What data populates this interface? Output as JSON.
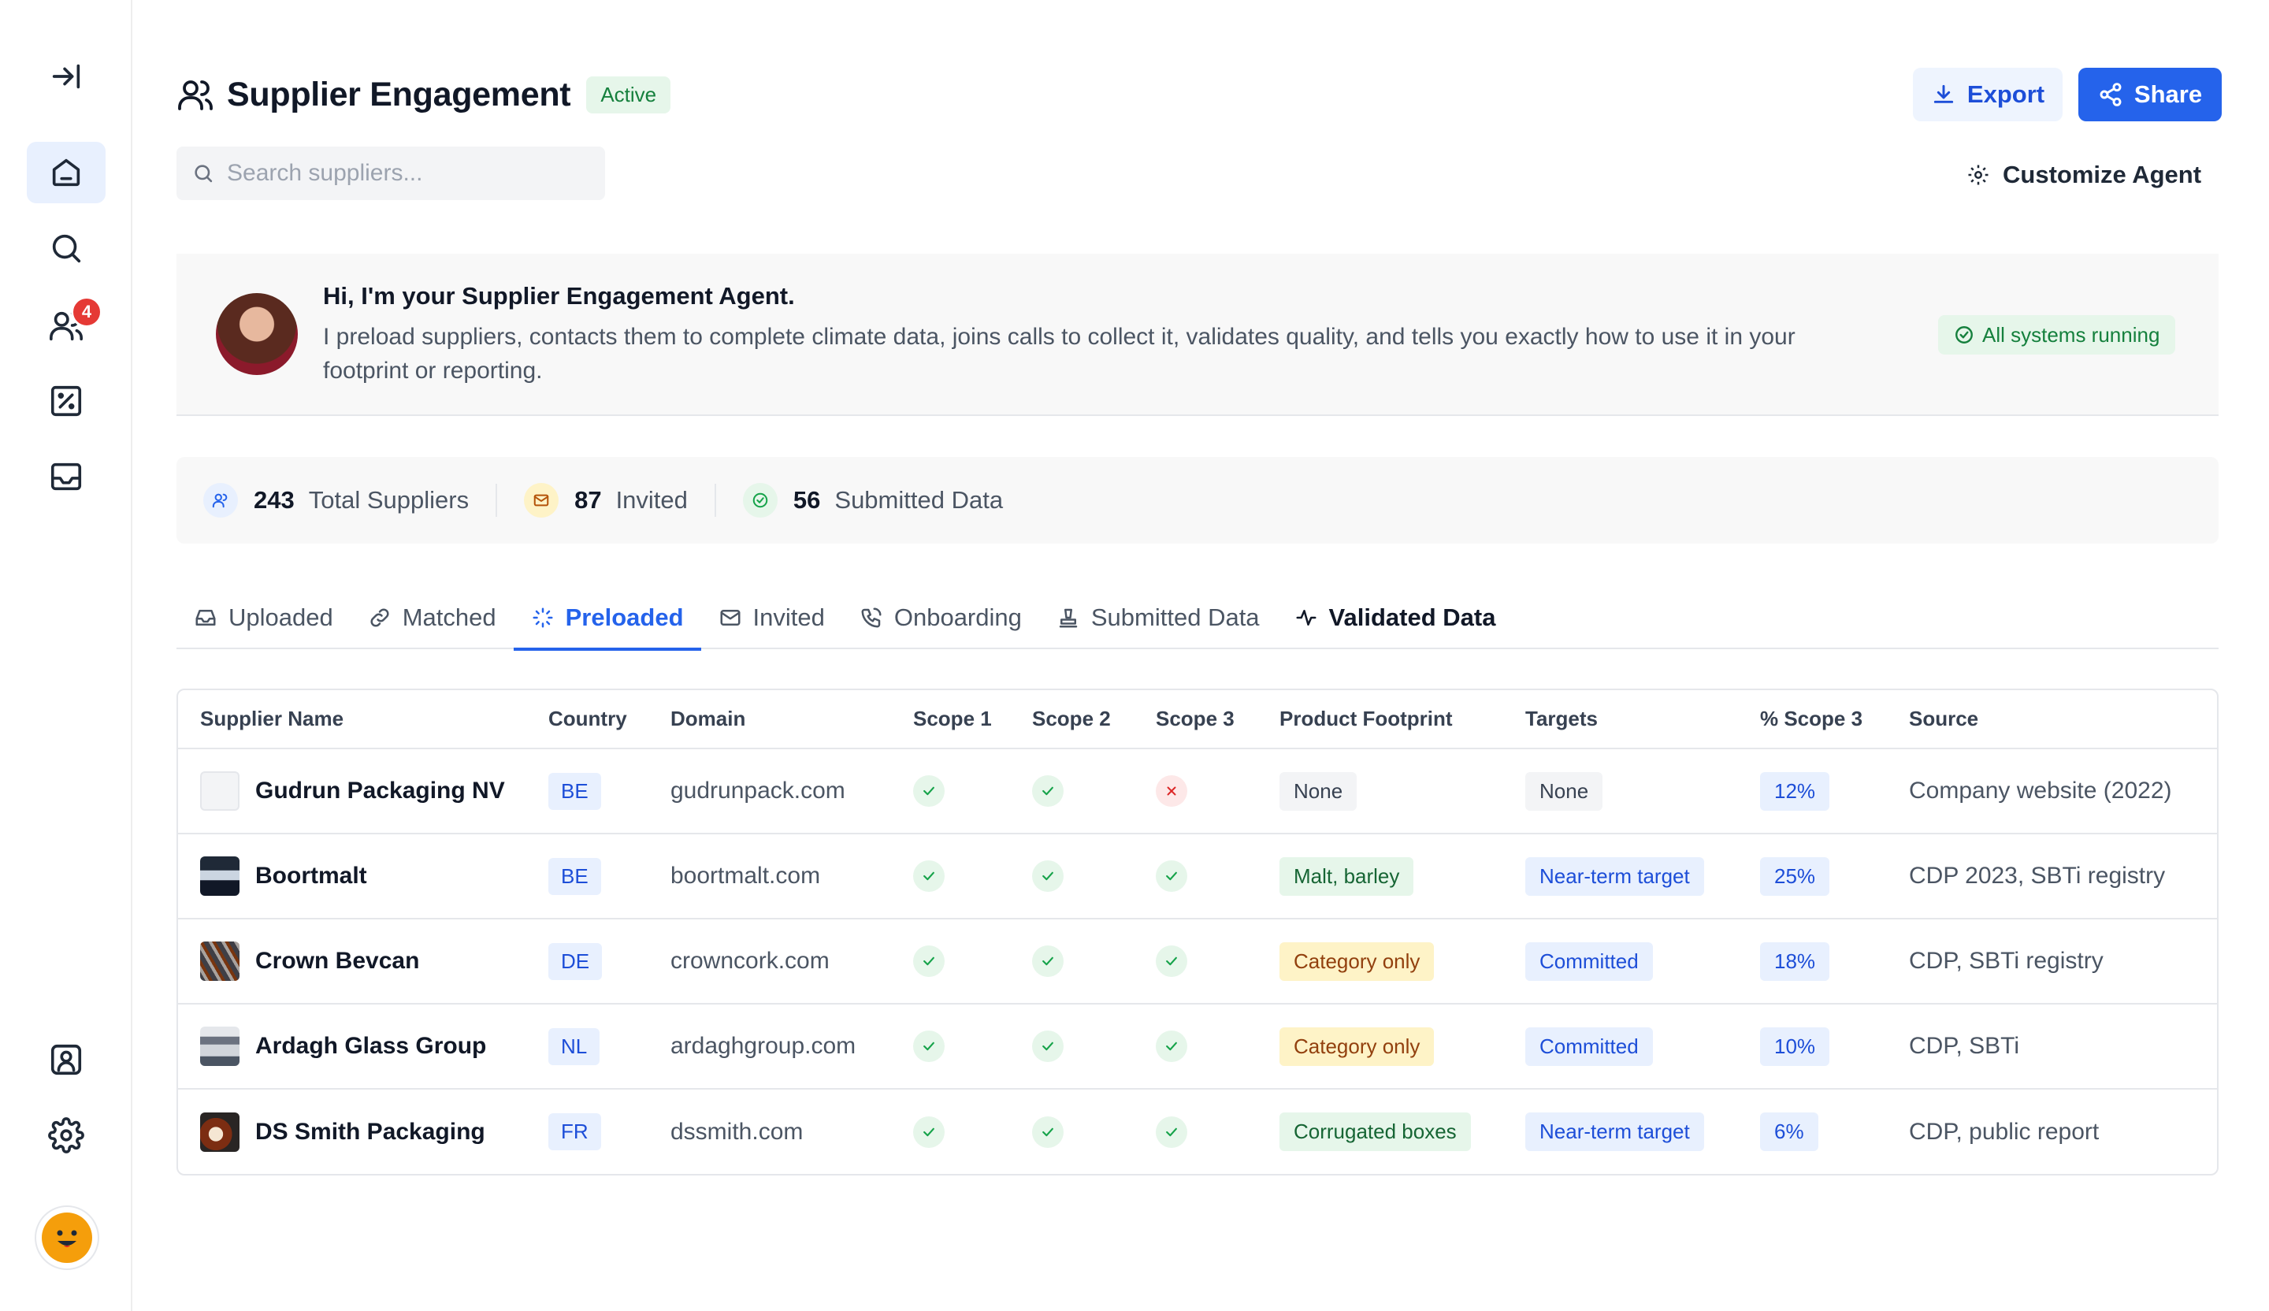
{
  "sidebar": {
    "notification_count": "4"
  },
  "header": {
    "title": "Supplier Engagement",
    "status": "Active",
    "export_label": "Export",
    "share_label": "Share",
    "customize_label": "Customize Agent"
  },
  "search": {
    "placeholder": "Search suppliers...",
    "value": ""
  },
  "agent": {
    "title": "Hi, I'm your Supplier Engagement Agent.",
    "description": "I preload suppliers, contacts them to complete climate data, joins calls to collect it, validates quality, and tells you exactly how to use it in your footprint or reporting.",
    "status": "All systems running"
  },
  "stats": [
    {
      "value": "243",
      "label": "Total Suppliers"
    },
    {
      "value": "87",
      "label": "Invited"
    },
    {
      "value": "56",
      "label": "Submitted Data"
    }
  ],
  "tabs": [
    {
      "label": "Uploaded"
    },
    {
      "label": "Matched"
    },
    {
      "label": "Preloaded"
    },
    {
      "label": "Invited"
    },
    {
      "label": "Onboarding"
    },
    {
      "label": "Submitted Data"
    },
    {
      "label": "Validated Data"
    }
  ],
  "table": {
    "columns": [
      "Supplier Name",
      "Country",
      "Domain",
      "Scope 1",
      "Scope 2",
      "Scope 3",
      "Product Footprint",
      "Targets",
      "% Scope 3",
      "Source"
    ],
    "rows": [
      {
        "name": "Gudrun Packaging NV",
        "country": "BE",
        "domain": "gudrunpack.com",
        "footprint": "None",
        "targets": "None",
        "scope3_pct": "12%",
        "source": "Company website (2022)"
      },
      {
        "name": "Boortmalt",
        "country": "BE",
        "domain": "boortmalt.com",
        "footprint": "Malt, barley",
        "targets": "Near-term target",
        "scope3_pct": "25%",
        "source": "CDP 2023, SBTi registry"
      },
      {
        "name": "Crown Bevcan",
        "country": "DE",
        "domain": "crowncork.com",
        "footprint": "Category only",
        "targets": "Committed",
        "scope3_pct": "18%",
        "source": "CDP, SBTi registry"
      },
      {
        "name": "Ardagh Glass Group",
        "country": "NL",
        "domain": "ardaghgroup.com",
        "footprint": "Category only",
        "targets": "Committed",
        "scope3_pct": "10%",
        "source": "CDP, SBTi"
      },
      {
        "name": "DS Smith Packaging",
        "country": "FR",
        "domain": "dssmith.com",
        "footprint": "Corrugated boxes",
        "targets": "Near-term target",
        "scope3_pct": "6%",
        "source": "CDP, public report"
      }
    ]
  },
  "colors": {
    "accent": "#2563eb",
    "success": "#16a34a",
    "danger": "#dc2626",
    "warning_bg": "#fef3c7"
  }
}
